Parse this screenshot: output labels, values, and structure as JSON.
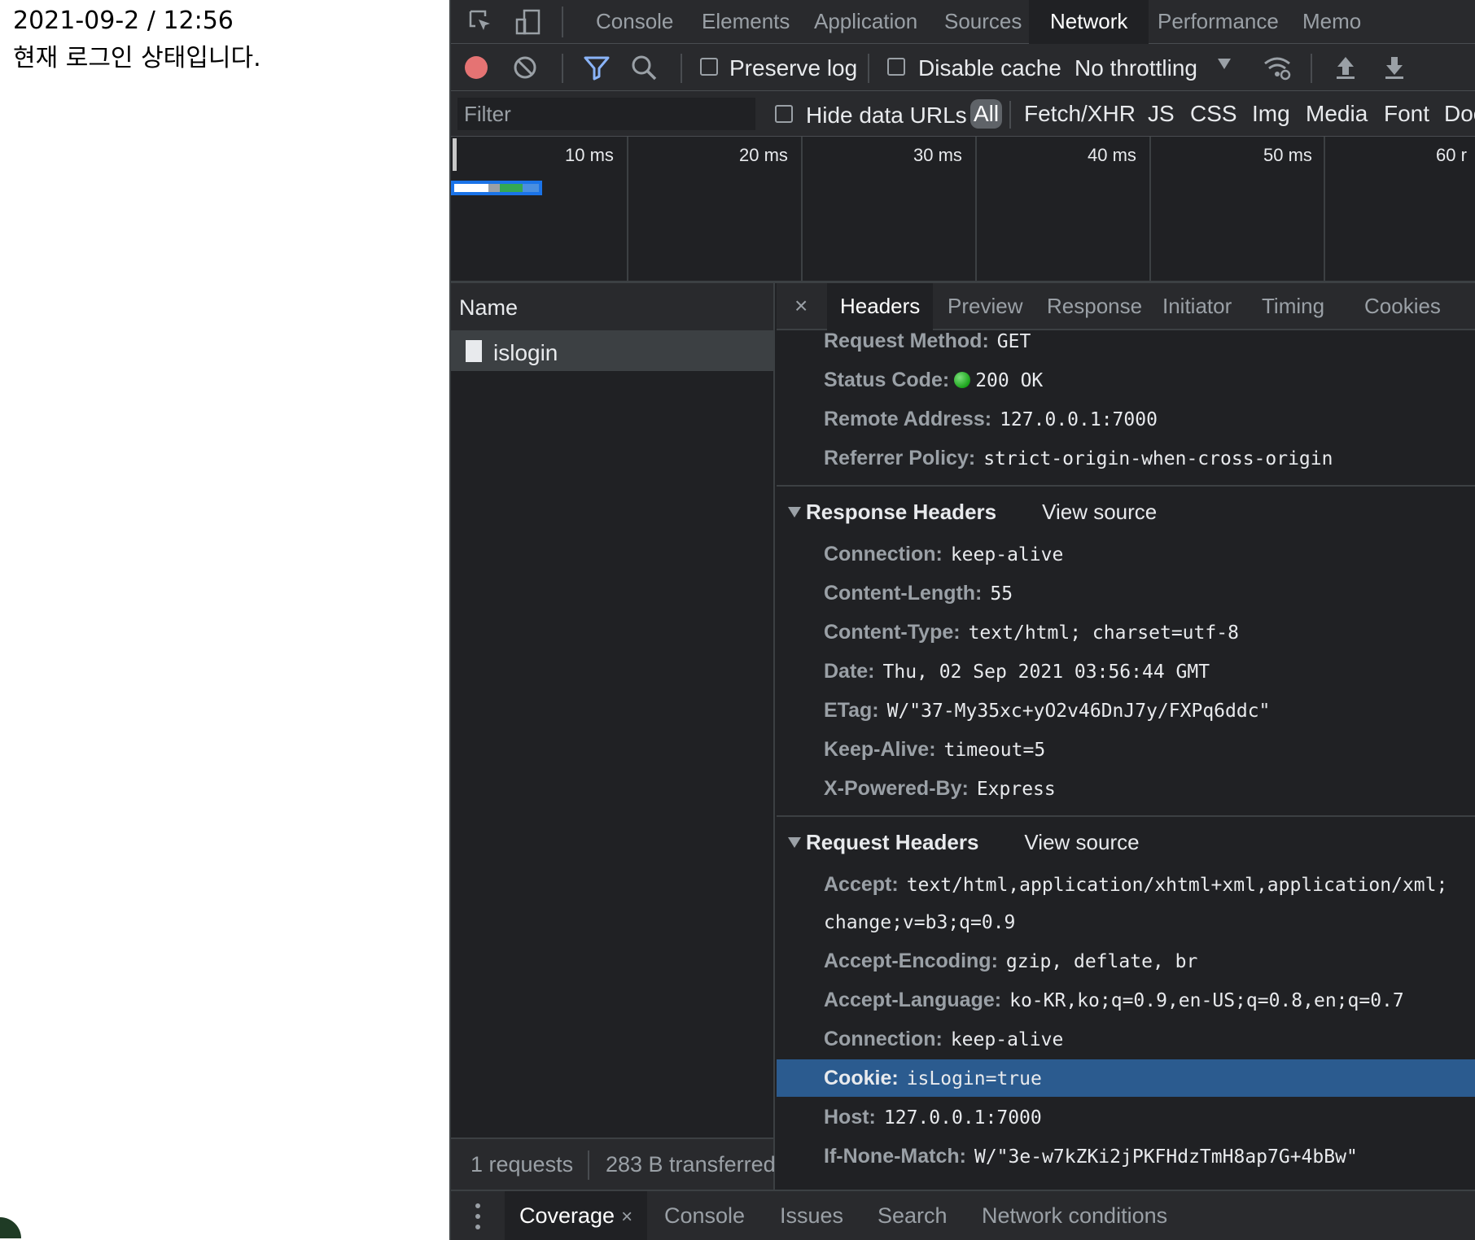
{
  "page": {
    "line1": "2021-09-2 / 12:56",
    "line2": "현재 로그인 상태입니다."
  },
  "devtools": {
    "main_tabs": [
      {
        "label": "Console"
      },
      {
        "label": "Elements"
      },
      {
        "label": "Application"
      },
      {
        "label": "Sources"
      },
      {
        "label": "Network"
      },
      {
        "label": "Performance"
      },
      {
        "label": "Memo"
      }
    ],
    "active_main_tab": "Network",
    "toolbar": {
      "preserve_log": "Preserve log",
      "disable_cache": "Disable cache",
      "throttling": "No throttling"
    },
    "filter": {
      "placeholder": "Filter",
      "hide_data_urls": "Hide data URLs",
      "types": [
        "All",
        "Fetch/XHR",
        "JS",
        "CSS",
        "Img",
        "Media",
        "Font",
        "Doc"
      ]
    },
    "timeline": {
      "ticks": [
        "10 ms",
        "20 ms",
        "30 ms",
        "40 ms",
        "50 ms",
        "60 r"
      ]
    },
    "requests": {
      "column": "Name",
      "items": [
        {
          "name": "islogin"
        }
      ],
      "status_count": "1 requests",
      "status_transferred": "283 B transferred"
    },
    "detail": {
      "close": "×",
      "tabs": [
        "Headers",
        "Preview",
        "Response",
        "Initiator",
        "Timing",
        "Cookies"
      ],
      "active_tab": "Headers",
      "general": [
        {
          "k": "Request Method:",
          "v": "GET"
        },
        {
          "k": "Status Code:",
          "v": "200 OK"
        },
        {
          "k": "Remote Address:",
          "v": "127.0.0.1:7000"
        },
        {
          "k": "Referrer Policy:",
          "v": "strict-origin-when-cross-origin"
        }
      ],
      "response_headers": {
        "title": "Response Headers",
        "view_source": "View source",
        "rows": [
          {
            "k": "Connection:",
            "v": "keep-alive"
          },
          {
            "k": "Content-Length:",
            "v": "55"
          },
          {
            "k": "Content-Type:",
            "v": "text/html; charset=utf-8"
          },
          {
            "k": "Date:",
            "v": "Thu, 02 Sep 2021 03:56:44 GMT"
          },
          {
            "k": "ETag:",
            "v": "W/\"37-My35xc+yO2v46DnJ7y/FXPq6ddc\""
          },
          {
            "k": "Keep-Alive:",
            "v": "timeout=5"
          },
          {
            "k": "X-Powered-By:",
            "v": "Express"
          }
        ]
      },
      "request_headers": {
        "title": "Request Headers",
        "view_source": "View source",
        "rows": [
          {
            "k": "Accept:",
            "v": "text/html,application/xhtml+xml,application/xml;"
          },
          {
            "k": "",
            "v": "change;v=b3;q=0.9"
          },
          {
            "k": "Accept-Encoding:",
            "v": "gzip, deflate, br"
          },
          {
            "k": "Accept-Language:",
            "v": "ko-KR,ko;q=0.9,en-US;q=0.8,en;q=0.7"
          },
          {
            "k": "Connection:",
            "v": "keep-alive"
          },
          {
            "k": "Cookie:",
            "v": "isLogin=true"
          },
          {
            "k": "Host:",
            "v": "127.0.0.1:7000"
          },
          {
            "k": "If-None-Match:",
            "v": "W/\"3e-w7kZKi2jPKFHdzTmH8ap7G+4bBw\""
          }
        ]
      }
    },
    "drawer": {
      "tabs": [
        {
          "label": "Coverage",
          "close": "×"
        },
        {
          "label": "Console"
        },
        {
          "label": "Issues"
        },
        {
          "label": "Search"
        },
        {
          "label": "Network conditions"
        }
      ],
      "active_tab": "Coverage"
    },
    "colors": {
      "background": "#202124",
      "toolbar": "#292a2d",
      "highlight_row": "#2b5b8f",
      "record": "#e57373",
      "filter_icon": "#8ab4f8"
    }
  }
}
